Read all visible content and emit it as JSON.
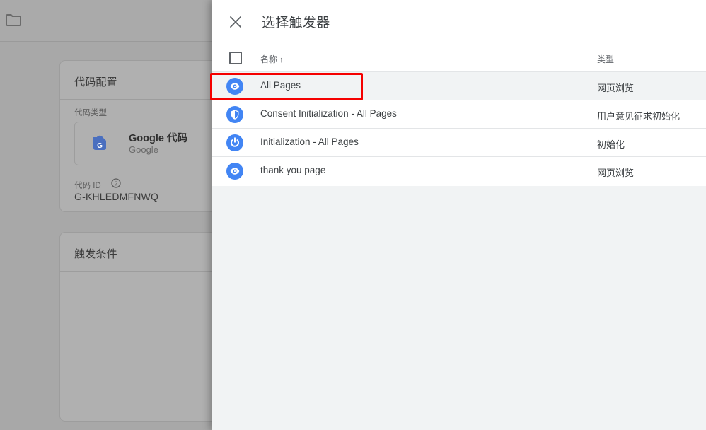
{
  "background": {
    "folder_icon": "folder-icon",
    "cards": [
      {
        "id": "tag-configuration",
        "title": "代码配置",
        "type_label": "代码类型",
        "help_icon": "help-circle-icon",
        "tag_icon": "google-tag-icon",
        "tag_name": "Google 代码",
        "tag_vendor": "Google",
        "id_label": "代码 ID",
        "id_value": "G-KHLEDMFNWQ"
      },
      {
        "id": "triggering",
        "title": "触发条件"
      }
    ]
  },
  "dialog": {
    "close_icon": "close-icon",
    "title": "选择触发器",
    "table": {
      "checkbox_icon": "checkbox-unchecked-icon",
      "columns": [
        {
          "key": "name",
          "label": "名称",
          "sort_arrow": "↑"
        },
        {
          "key": "type",
          "label": "类型",
          "sort_arrow": ""
        }
      ],
      "rows": [
        {
          "icon": "eye-pageview-icon",
          "name": "All Pages",
          "type": "网页浏览",
          "highlighted": true
        },
        {
          "icon": "shield-consent-icon",
          "name": "Consent Initialization - All Pages",
          "type": "用户意见征求初始化",
          "highlighted": false
        },
        {
          "icon": "power-init-icon",
          "name": "Initialization - All Pages",
          "type": "初始化",
          "highlighted": false
        },
        {
          "icon": "eye-pageview-icon",
          "name": "thank you page",
          "type": "网页浏览",
          "highlighted": false
        }
      ]
    }
  },
  "annotation": {
    "highlight_color": "#f50000",
    "target": "All Pages"
  },
  "colors": {
    "accent_blue": "#4285f4",
    "row_hover": "#f1f3f4",
    "text_primary": "#3c4043",
    "text_secondary": "#5f6368",
    "divider": "#e3e5e7"
  }
}
